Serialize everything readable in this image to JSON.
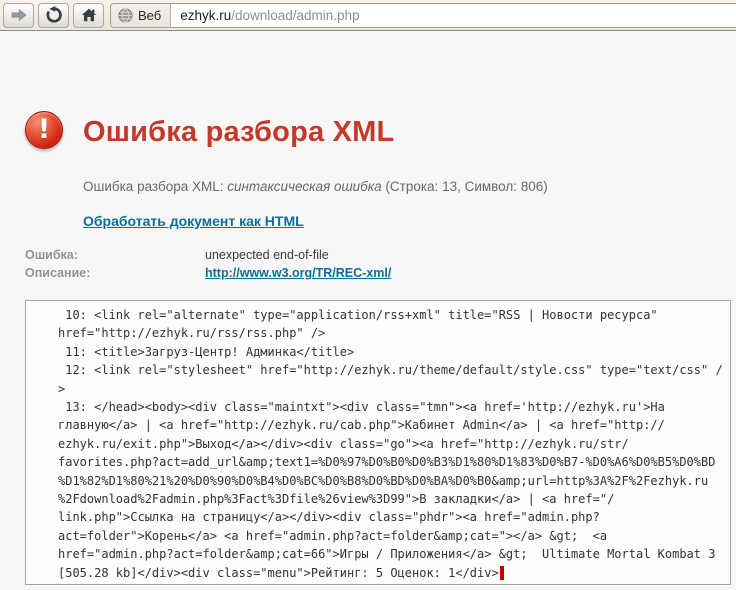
{
  "browser": {
    "search_label": "Веб",
    "url_domain": "ezhyk.ru",
    "url_path": "/download/admin.php"
  },
  "error": {
    "title": "Ошибка разбора XML",
    "summary_prefix": "Ошибка разбора XML: ",
    "summary_italic": "синтаксическая ошибка",
    "summary_suffix": " (Строка: 13, Символ: 806)",
    "action_link": "Обработать документ как HTML",
    "details": {
      "error_label": "Ошибка:",
      "error_value": "unexpected end-of-file",
      "description_label": "Описание:",
      "description_link": "http://www.w3.org/TR/REC-xml/"
    }
  },
  "code": {
    "lines": [
      " 10: <link rel=\"alternate\" type=\"application/rss+xml\" title=\"RSS | Новости ресурса\"",
      "href=\"http://ezhyk.ru/rss/rss.php\" />",
      " 11: <title>Загруз-Центр! Админка</title>",
      " 12: <link rel=\"stylesheet\" href=\"http://ezhyk.ru/theme/default/style.css\" type=\"text/css\" /",
      ">",
      " 13: </head><body><div class=\"maintxt\"><div class=\"tmn\"><a href='http://ezhyk.ru'>На",
      "главную</a> | <a href=\"http://ezhyk.ru/cab.php\">Кабинет Admin</a> | <a href=\"http://",
      "ezhyk.ru/exit.php\">Выход</a></div><div class=\"go\"><a href=\"http://ezhyk.ru/str/",
      "favorites.php?act=add_url&amp;text1=%D0%97%D0%B0%D0%B3%D1%80%D1%83%D0%B7-%D0%A6%D0%B5%D0%BD",
      "%D1%82%D1%80%21%20%D0%90%D0%B4%D0%BC%D0%B8%D0%BD%D0%BA%D0%B0&amp;url=http%3A%2F%2Fezhyk.ru",
      "%2Fdownload%2Fadmin.php%3Fact%3Dfile%26view%3D99\">В закладки</a> | <a href=\"/",
      "link.php\">Ссылка на страницу</a></div><div class=\"phdr\"><a href=\"admin.php?",
      "act=folder\">Корень</a> <a href=\"admin.php?act=folder&amp;cat=\"></a> &gt;  <a",
      "href=\"admin.php?act=folder&amp;cat=66\">Игры / Приложения</a> &gt;  Ultimate Mortal Kombat 3",
      "[505.28 kb]</div><div class=\"menu\">Рейтинг: 5 Оценок: 1</div>"
    ]
  },
  "colors": {
    "accent_red": "#c5392b",
    "link_teal": "#0d6e9c",
    "caret_red": "#c00000",
    "toolbar_cream": "#f0ebdf",
    "page_background": "#f7f7f7"
  }
}
